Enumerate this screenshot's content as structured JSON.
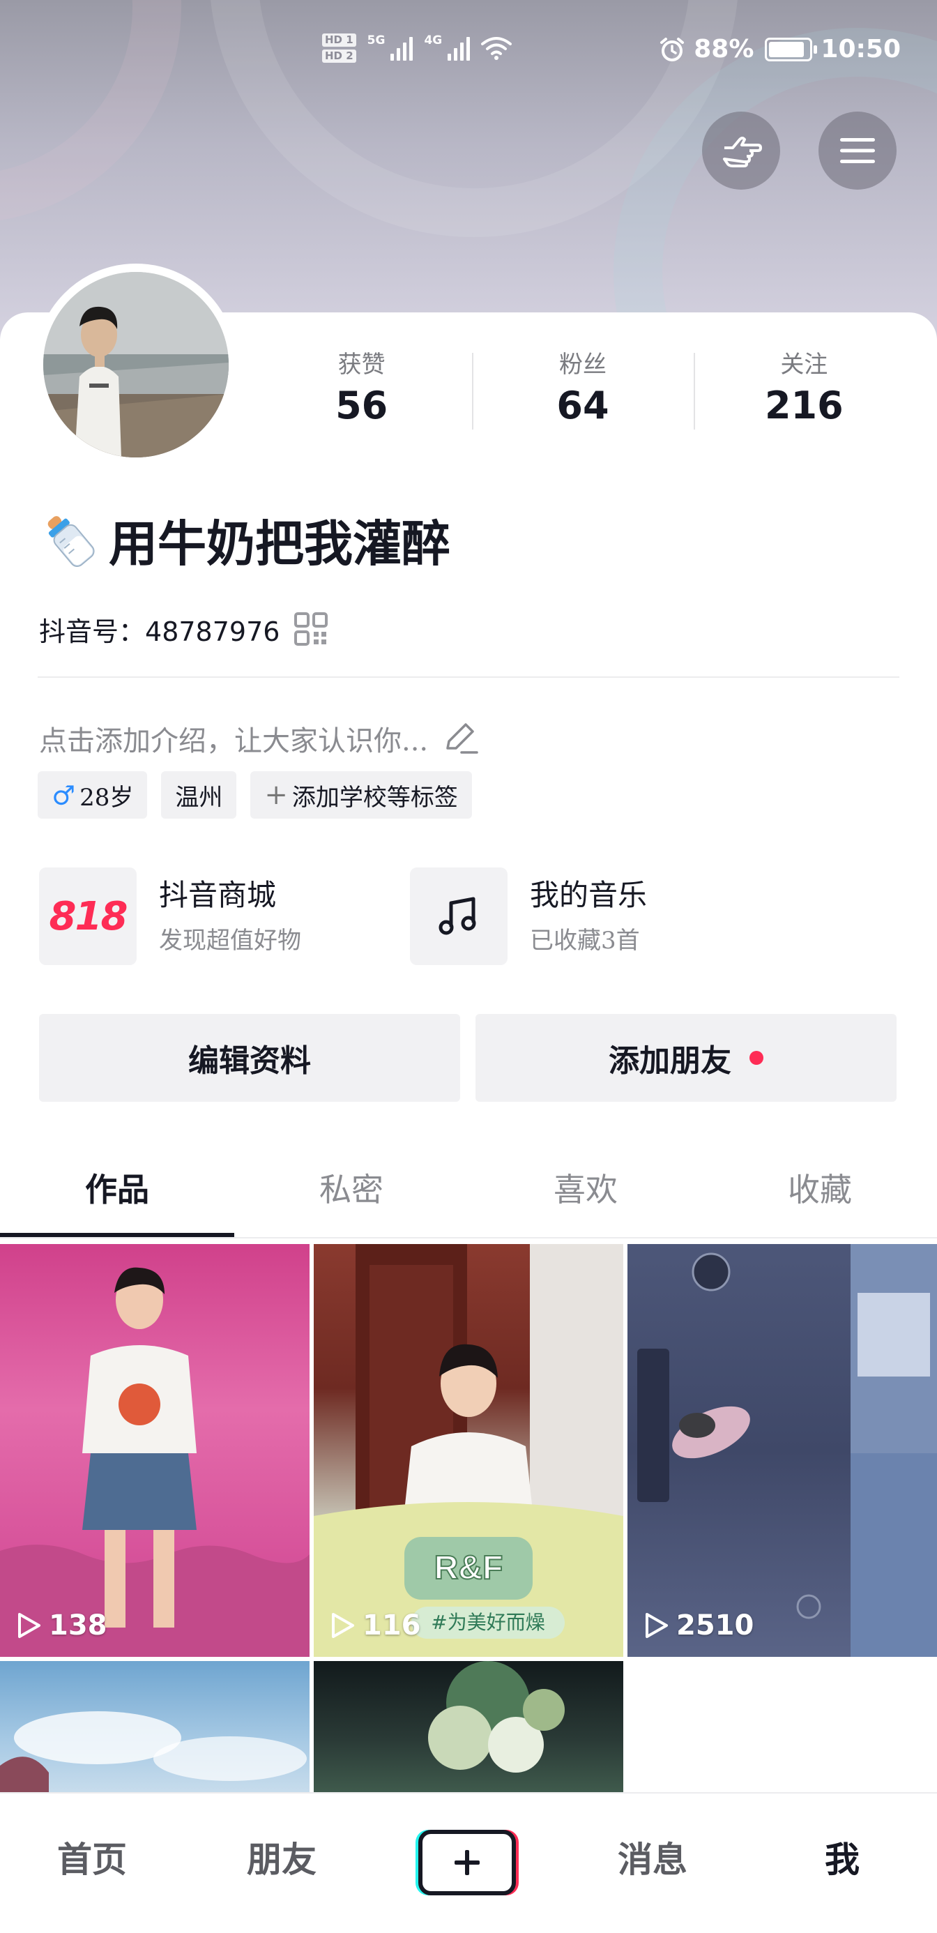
{
  "status_bar": {
    "hd1": "HD 1",
    "hd2": "HD 2",
    "net1": "5G",
    "net2": "4G",
    "battery_percent": "88%",
    "battery_level": 0.88,
    "time": "10:50"
  },
  "header": {
    "left_button_icon": "hand-pointing-icon",
    "right_button_icon": "menu-icon"
  },
  "profile": {
    "nickname": "用牛奶把我灌醉",
    "nickname_emoji": "🍼",
    "account_label": "抖音号：",
    "account_id": "48787976",
    "intro_placeholder": "点击添加介绍，让大家认识你...",
    "stats": [
      {
        "label": "获赞",
        "value": "56"
      },
      {
        "label": "粉丝",
        "value": "64"
      },
      {
        "label": "关注",
        "value": "216"
      }
    ],
    "tags": {
      "gender_symbol": "♂",
      "age": "28岁",
      "location": "温州",
      "add_tag": "添加学校等标签"
    }
  },
  "shortcuts": [
    {
      "logo": "818",
      "title": "抖音商城",
      "subtitle": "发现超值好物"
    },
    {
      "icon": "music-note-icon",
      "title": "我的音乐",
      "subtitle": "已收藏3首"
    }
  ],
  "actions": {
    "edit_profile": "编辑资料",
    "add_friends": "添加朋友"
  },
  "tabs": [
    "作品",
    "私密",
    "喜欢",
    "收藏"
  ],
  "active_tab": "作品",
  "videos": [
    {
      "plays": "138"
    },
    {
      "plays": "116",
      "caption_tag": "#为美好而燥",
      "overlay_text": "R&F"
    },
    {
      "plays": "2510"
    }
  ],
  "bottom_nav": {
    "home": "首页",
    "friends": "朋友",
    "create": "+",
    "messages": "消息",
    "me": "我"
  },
  "colors": {
    "accent_red": "#fe2c55",
    "accent_cyan": "#25f4ee",
    "text_primary": "#161823",
    "text_secondary": "#8a8b90"
  }
}
